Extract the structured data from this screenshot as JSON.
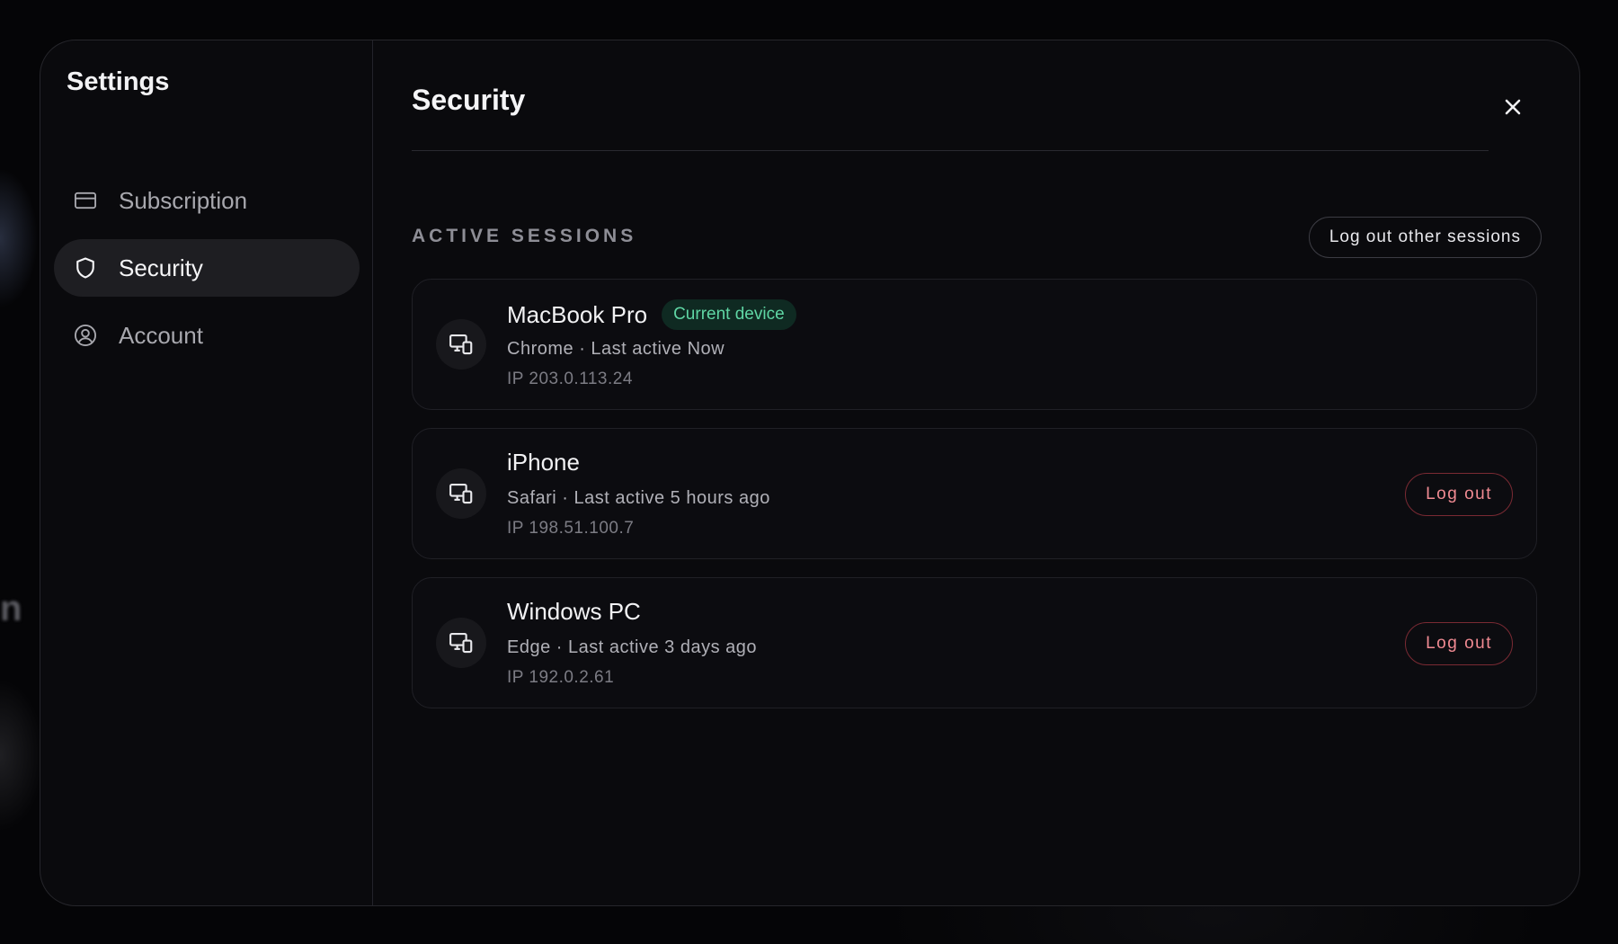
{
  "sidebar": {
    "title": "Settings",
    "items": [
      {
        "label": "Subscription",
        "icon": "credit-card-icon",
        "active": false
      },
      {
        "label": "Security",
        "icon": "shield-icon",
        "active": true
      },
      {
        "label": "Account",
        "icon": "user-circle-icon",
        "active": false
      }
    ]
  },
  "main": {
    "title": "Security",
    "close_icon": "close-icon",
    "section_label": "ACTIVE SESSIONS",
    "logout_others_label": "Log out other sessions",
    "sessions": [
      {
        "device": "MacBook Pro",
        "badge": "Current device",
        "meta": "Chrome · Last active Now",
        "ip": "IP 203.0.113.24",
        "icon": "devices-icon",
        "logout_label": ""
      },
      {
        "device": "iPhone",
        "badge": "",
        "meta": "Safari · Last active 5 hours ago",
        "ip": "IP 198.51.100.7",
        "icon": "devices-icon",
        "logout_label": "Log out"
      },
      {
        "device": "Windows PC",
        "badge": "",
        "meta": "Edge · Last active 3 days ago",
        "ip": "IP 192.0.2.61",
        "icon": "devices-icon",
        "logout_label": "Log out"
      }
    ]
  },
  "background": {
    "partial_text": "n"
  },
  "colors": {
    "accent_green": "#5fd6a4",
    "danger_red": "#f08a92",
    "modal_bg": "#0a0a0d"
  }
}
